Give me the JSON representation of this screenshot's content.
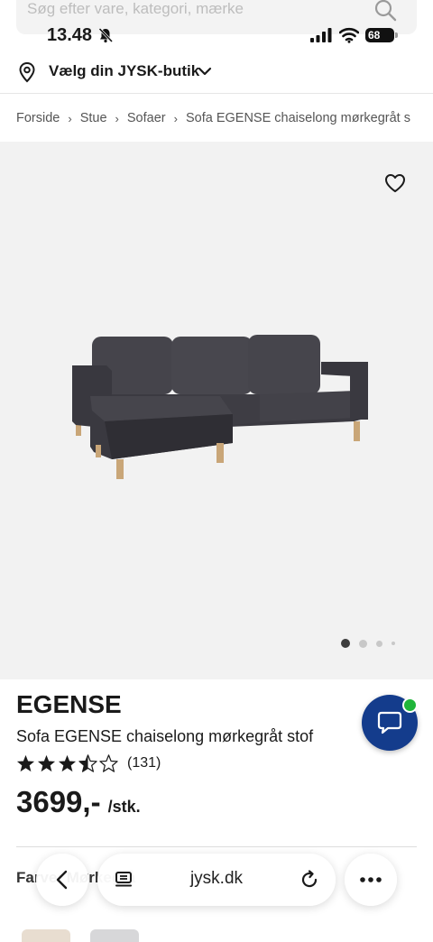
{
  "search": {
    "placeholder": "Søg efter vare, kategori, mærke"
  },
  "status_bar": {
    "time": "13.48",
    "battery": "68"
  },
  "store": {
    "label": "Vælg din JYSK-butik"
  },
  "breadcrumb": {
    "items": [
      "Forside",
      "Stue",
      "Sofaer",
      "Sofa EGENSE chaiselong mørkegråt s"
    ]
  },
  "gallery": {
    "image_count": 4,
    "active_index": 0
  },
  "product": {
    "name": "EGENSE",
    "description": "Sofa EGENSE chaiselong mørkegråt stof",
    "rating": 3.5,
    "review_count": "(131)",
    "price": "3699,-",
    "unit": "/stk."
  },
  "color_section": {
    "label": "Farve: Mørkegrå"
  },
  "browser": {
    "url": "jysk.dk"
  },
  "colors": {
    "chat_button": "#143c8c",
    "online": "#1fb53a",
    "image_bg": "#f2f2f2"
  }
}
